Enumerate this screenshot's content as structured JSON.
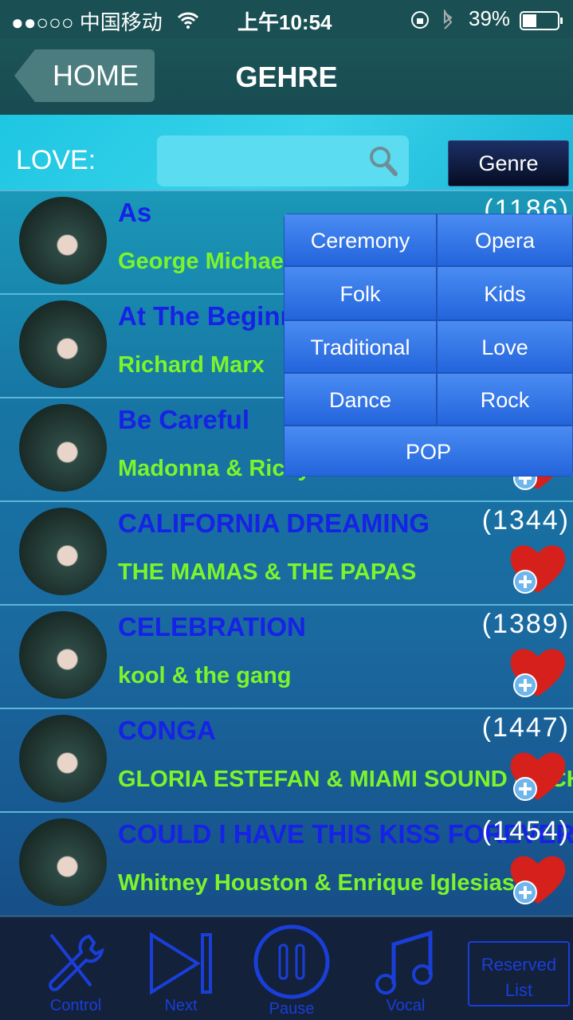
{
  "status": {
    "carrier": "●●○○○ 中国移动",
    "time": "上午10:54",
    "battery": "39%"
  },
  "nav": {
    "back_label": "HOME",
    "title": "GEHRE"
  },
  "search": {
    "label": "LOVE:",
    "value": "",
    "genre_button": "Genre"
  },
  "songs": [
    {
      "title": "As",
      "artist": "George Michael",
      "count": "(1186)"
    },
    {
      "title": "At The Beginning",
      "artist": "Richard Marx",
      "count": ""
    },
    {
      "title": "Be Careful",
      "artist": "Madonna & Ricky Martin",
      "count": ""
    },
    {
      "title": "CALIFORNIA DREAMING",
      "artist": "THE MAMAS & THE PAPAS",
      "count": "(1344)"
    },
    {
      "title": "CELEBRATION",
      "artist": "kool & the gang",
      "count": "(1389)"
    },
    {
      "title": "CONGA",
      "artist": "GLORIA ESTEFAN & MIAMI SOUND MACHINE",
      "count": "(1447)"
    },
    {
      "title": "COULD I HAVE THIS KISS FOREVER",
      "artist": "Whitney Houston & Enrique Iglesias",
      "count": "(1454)"
    }
  ],
  "genres": [
    "Ceremony",
    "Opera",
    "Folk",
    "Kids",
    "Traditional",
    "Love",
    "Dance",
    "Rock",
    "POP"
  ],
  "footer": {
    "control": "Control",
    "next": "Next",
    "pause": "Pause",
    "vocal": "Vocal",
    "reserved": "Reserved List"
  },
  "colors": {
    "title": "#1622e6",
    "artist": "#7cf42a",
    "accent": "#1a3fd8"
  }
}
